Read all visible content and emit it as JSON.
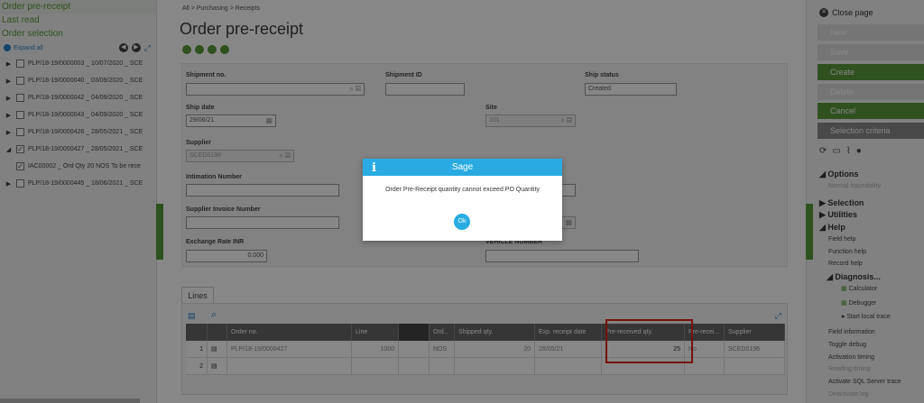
{
  "left": {
    "nav": [
      "Order pre-receipt",
      "Last read",
      "Order selection"
    ],
    "expand_all": "Expand all",
    "tree": [
      {
        "text": "PLP/18-19/0000003 _ 10/07/2020 _ SCE",
        "expanded": false,
        "checked": false
      },
      {
        "text": "PLP/18-19/0000040 _ 03/09/2020 _ SCE",
        "expanded": false,
        "checked": false
      },
      {
        "text": "PLP/18-19/0000042 _ 04/09/2020 _ SCE",
        "expanded": false,
        "checked": false
      },
      {
        "text": "PLP/18-19/0000043 _ 04/09/2020 _ SCE",
        "expanded": false,
        "checked": false
      },
      {
        "text": "PLP/18-19/0000426 _ 28/05/2021 _ SCE",
        "expanded": false,
        "checked": false
      },
      {
        "text": "PLP/18-19/0000427 _ 28/05/2021 _ SCE",
        "expanded": true,
        "checked": true
      },
      {
        "text": "IAC00002 _ Ord Qty 20 NOS To be rece",
        "child": true,
        "checked": true
      },
      {
        "text": "PLP/18-19/0000445 _ 18/06/2021 _ SCE",
        "expanded": false,
        "checked": false
      }
    ]
  },
  "breadcrumb": {
    "a": "All",
    "b": "Purchasing",
    "c": "Receipts"
  },
  "page_title": "Order pre-receipt",
  "form": {
    "shipment_no_label": "Shipment no.",
    "shipment_no": "",
    "shipment_id_label": "Shipment ID",
    "shipment_id": "",
    "ship_status_label": "Ship status",
    "ship_status": "Created",
    "ship_date_label": "Ship date",
    "ship_date": "29/06/21",
    "site_label": "Site",
    "site": "101",
    "supplier_label": "Supplier",
    "supplier": "SCED0196",
    "intimation_label": "Intimation Number",
    "intimation": "",
    "supplier_invoice_label": "Supplier Invoice Number",
    "supplier_invoice": "",
    "exchange_rate_label": "Exchange Rate INR",
    "exchange_rate": "0.000",
    "vehicle_label": "VEHICLE NUMBER",
    "vehicle": ""
  },
  "lines_tab": "Lines",
  "grid": {
    "headers": [
      "",
      "",
      "Order no.",
      "Line",
      "",
      "Ord...",
      "Shipped qty.",
      "Exp. receipt date",
      "Pre-received qty.",
      "Pre-recei...",
      "Supplier"
    ],
    "rows": [
      [
        "1",
        "",
        "PLP/18-19/0000427",
        "1000",
        "",
        "NOS",
        "20",
        "28/05/21",
        "25",
        "No",
        "SCED0196"
      ],
      [
        "2",
        "",
        "",
        "",
        "",
        "",
        "",
        "",
        "",
        "",
        ""
      ]
    ]
  },
  "right": {
    "close_page": "Close page",
    "actions": [
      "New",
      "Save",
      "Create",
      "Delete",
      "Cancel",
      "Selection criteria"
    ],
    "options": "Options",
    "options_item": "Normal traceability",
    "selection": "Selection",
    "utilities": "Utilities",
    "help": "Help",
    "help_items": [
      "Field help",
      "Function help",
      "Record help"
    ],
    "diagnosis": "Diagnosis...",
    "diag_items": [
      "Calculator",
      "Debugger",
      "Start local trace"
    ],
    "more_items": [
      "Field information",
      "Toggle debug",
      "Activation timing",
      "Reading timing",
      "Activate SQL Server trace",
      "Deactivate log"
    ]
  },
  "dialog": {
    "title": "Sage",
    "message": "Order Pre-Receipt quantity cannot exceed PO Quantity",
    "ok": "Ok"
  },
  "colors": {
    "accent": "#5a9a3c",
    "dialog_header": "#29abe2",
    "highlight": "#e0201b"
  }
}
